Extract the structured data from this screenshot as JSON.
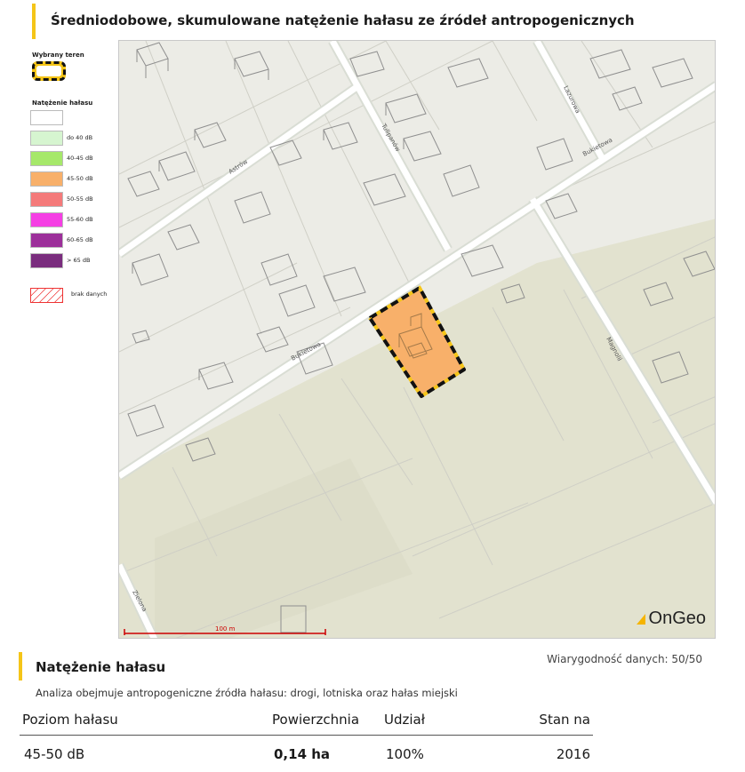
{
  "title": "Średniodobowe, skumulowane natężenie hałasu ze źródeł antropogenicznych",
  "legend": {
    "selected_heading": "Wybrany teren",
    "noise_heading": "Natężenie hałasu",
    "items": [
      {
        "label": "",
        "color": "#ffffff"
      },
      {
        "label": "do 40 dB",
        "color": "#d6f5d0"
      },
      {
        "label": "40-45 dB",
        "color": "#a6e86a"
      },
      {
        "label": "45-50 dB",
        "color": "#f8b06a"
      },
      {
        "label": "50-55 dB",
        "color": "#f47a7a"
      },
      {
        "label": "55-60 dB",
        "color": "#f53fe4"
      },
      {
        "label": "60-65 dB",
        "color": "#9c2f9a"
      },
      {
        "label": "> 65 dB",
        "color": "#7a2d7e"
      }
    ],
    "no_data_label": "brak danych"
  },
  "map": {
    "streets": [
      "Astrów",
      "Tulipanów",
      "Lazurowa",
      "Bukietowa",
      "Bukietowa",
      "Magnolii",
      "Zielona"
    ],
    "scale_label": "100 m",
    "logo": "OnGeo",
    "selected_fill": "#f8b06a"
  },
  "section": {
    "title": "Natężenie hałasu",
    "reliability": "Wiarygodność danych: 50/50",
    "description": "Analiza obejmuje antropogeniczne źródła hałasu: drogi, lotniska oraz hałas miejski"
  },
  "table": {
    "headers": [
      "Poziom hałasu",
      "Powierzchnia",
      "Udział",
      "Stan na"
    ],
    "rows": [
      {
        "level": "45-50 dB",
        "area": "0,14 ha",
        "share": "100%",
        "year": "2016"
      }
    ]
  },
  "colors": {
    "accent": "#f5c518"
  }
}
